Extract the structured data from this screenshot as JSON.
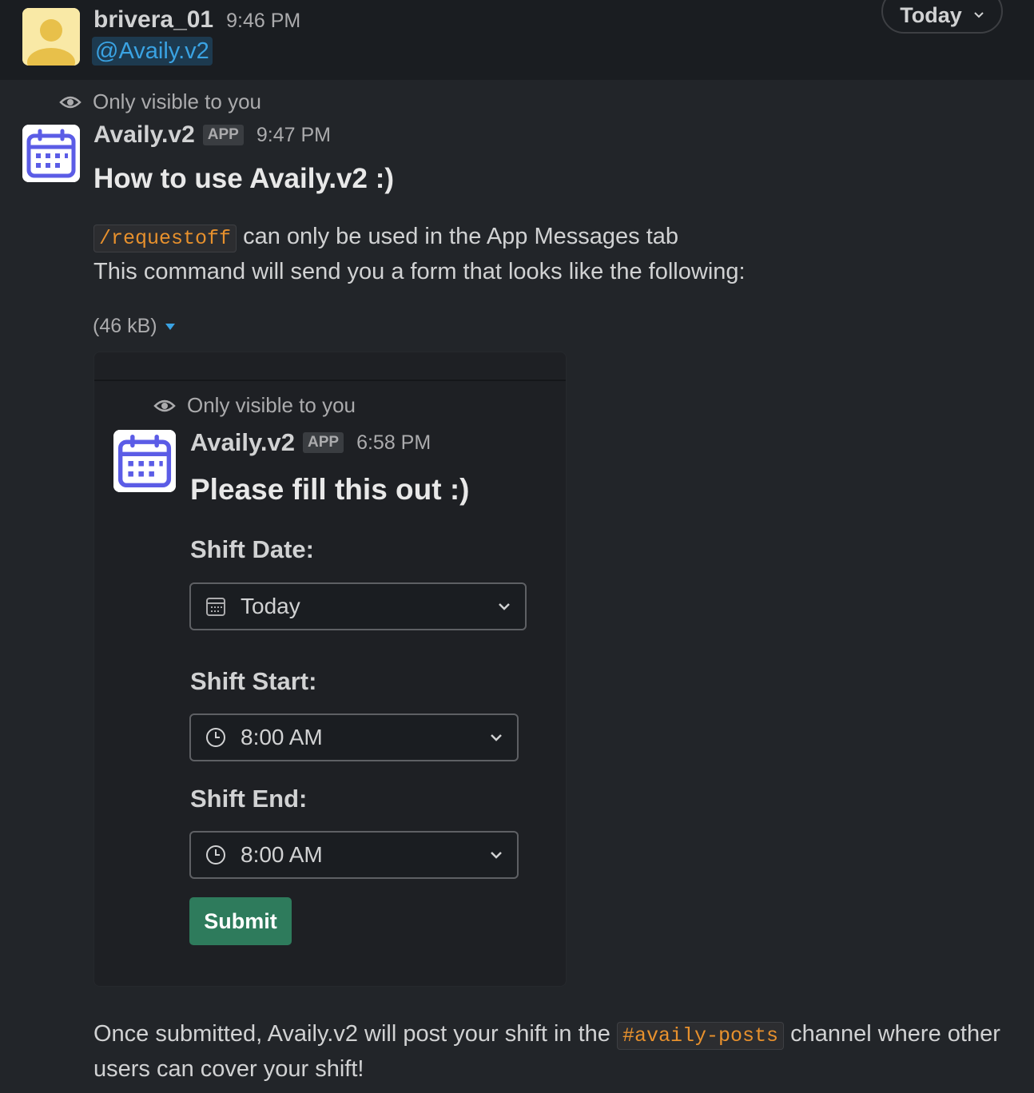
{
  "top_message": {
    "username": "brivera_01",
    "time": "9:46 PM",
    "mention": "@Availy.v2"
  },
  "date_pill": {
    "label": "Today"
  },
  "bot_message": {
    "visibility": "Only visible to you",
    "app_name": "Availy.v2",
    "badge": "APP",
    "time": "9:47 PM",
    "heading": "How to use Availy.v2 :)",
    "command": "/requestoff",
    "line1_rest": "can only be used in the App Messages tab",
    "line2": "This command will send you a form that looks like the following:",
    "attachment_size": "(46 kB)"
  },
  "preview": {
    "visibility": "Only visible to you",
    "app_name": "Availy.v2",
    "badge": "APP",
    "time": "6:58 PM",
    "heading": "Please fill this out :)",
    "date_label": "Shift Date:",
    "date_value": "Today",
    "start_label": "Shift Start:",
    "start_value": "8:00 AM",
    "end_label": "Shift End:",
    "end_value": "8:00 AM",
    "submit": "Submit"
  },
  "footer": {
    "part1": "Once submitted, Availy.v2 will post your shift in the",
    "channel": "#availy-posts",
    "part2": "channel where other",
    "line2": "users can cover your shift!"
  },
  "colors": {
    "background": "#1a1d21",
    "message_bg": "#222529",
    "mention": "#3aa3e3",
    "code": "#e8912d",
    "submit": "#2e7b5c",
    "calendar_icon": "#5b5ce6"
  }
}
